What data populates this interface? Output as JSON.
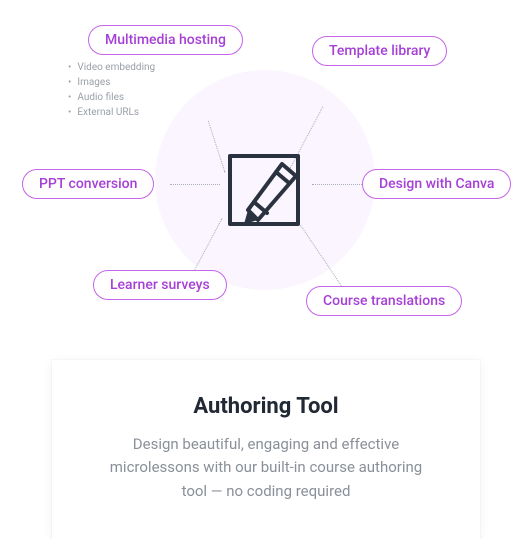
{
  "diagram": {
    "center_icon": "pencil-document-icon",
    "pills": {
      "multimedia": "Multimedia hosting",
      "template": "Template library",
      "ppt": "PPT conversion",
      "canva": "Design with Canva",
      "surveys": "Learner surveys",
      "translations": "Course translations"
    },
    "multimedia_sub": {
      "video": "Video embedding",
      "images": "Images",
      "audio": "Audio files",
      "urls": "External URLs"
    }
  },
  "card": {
    "title": "Authoring Tool",
    "description": "Design beautiful, engaging and effective microlessons with our built-in course authoring tool — no coding required"
  }
}
